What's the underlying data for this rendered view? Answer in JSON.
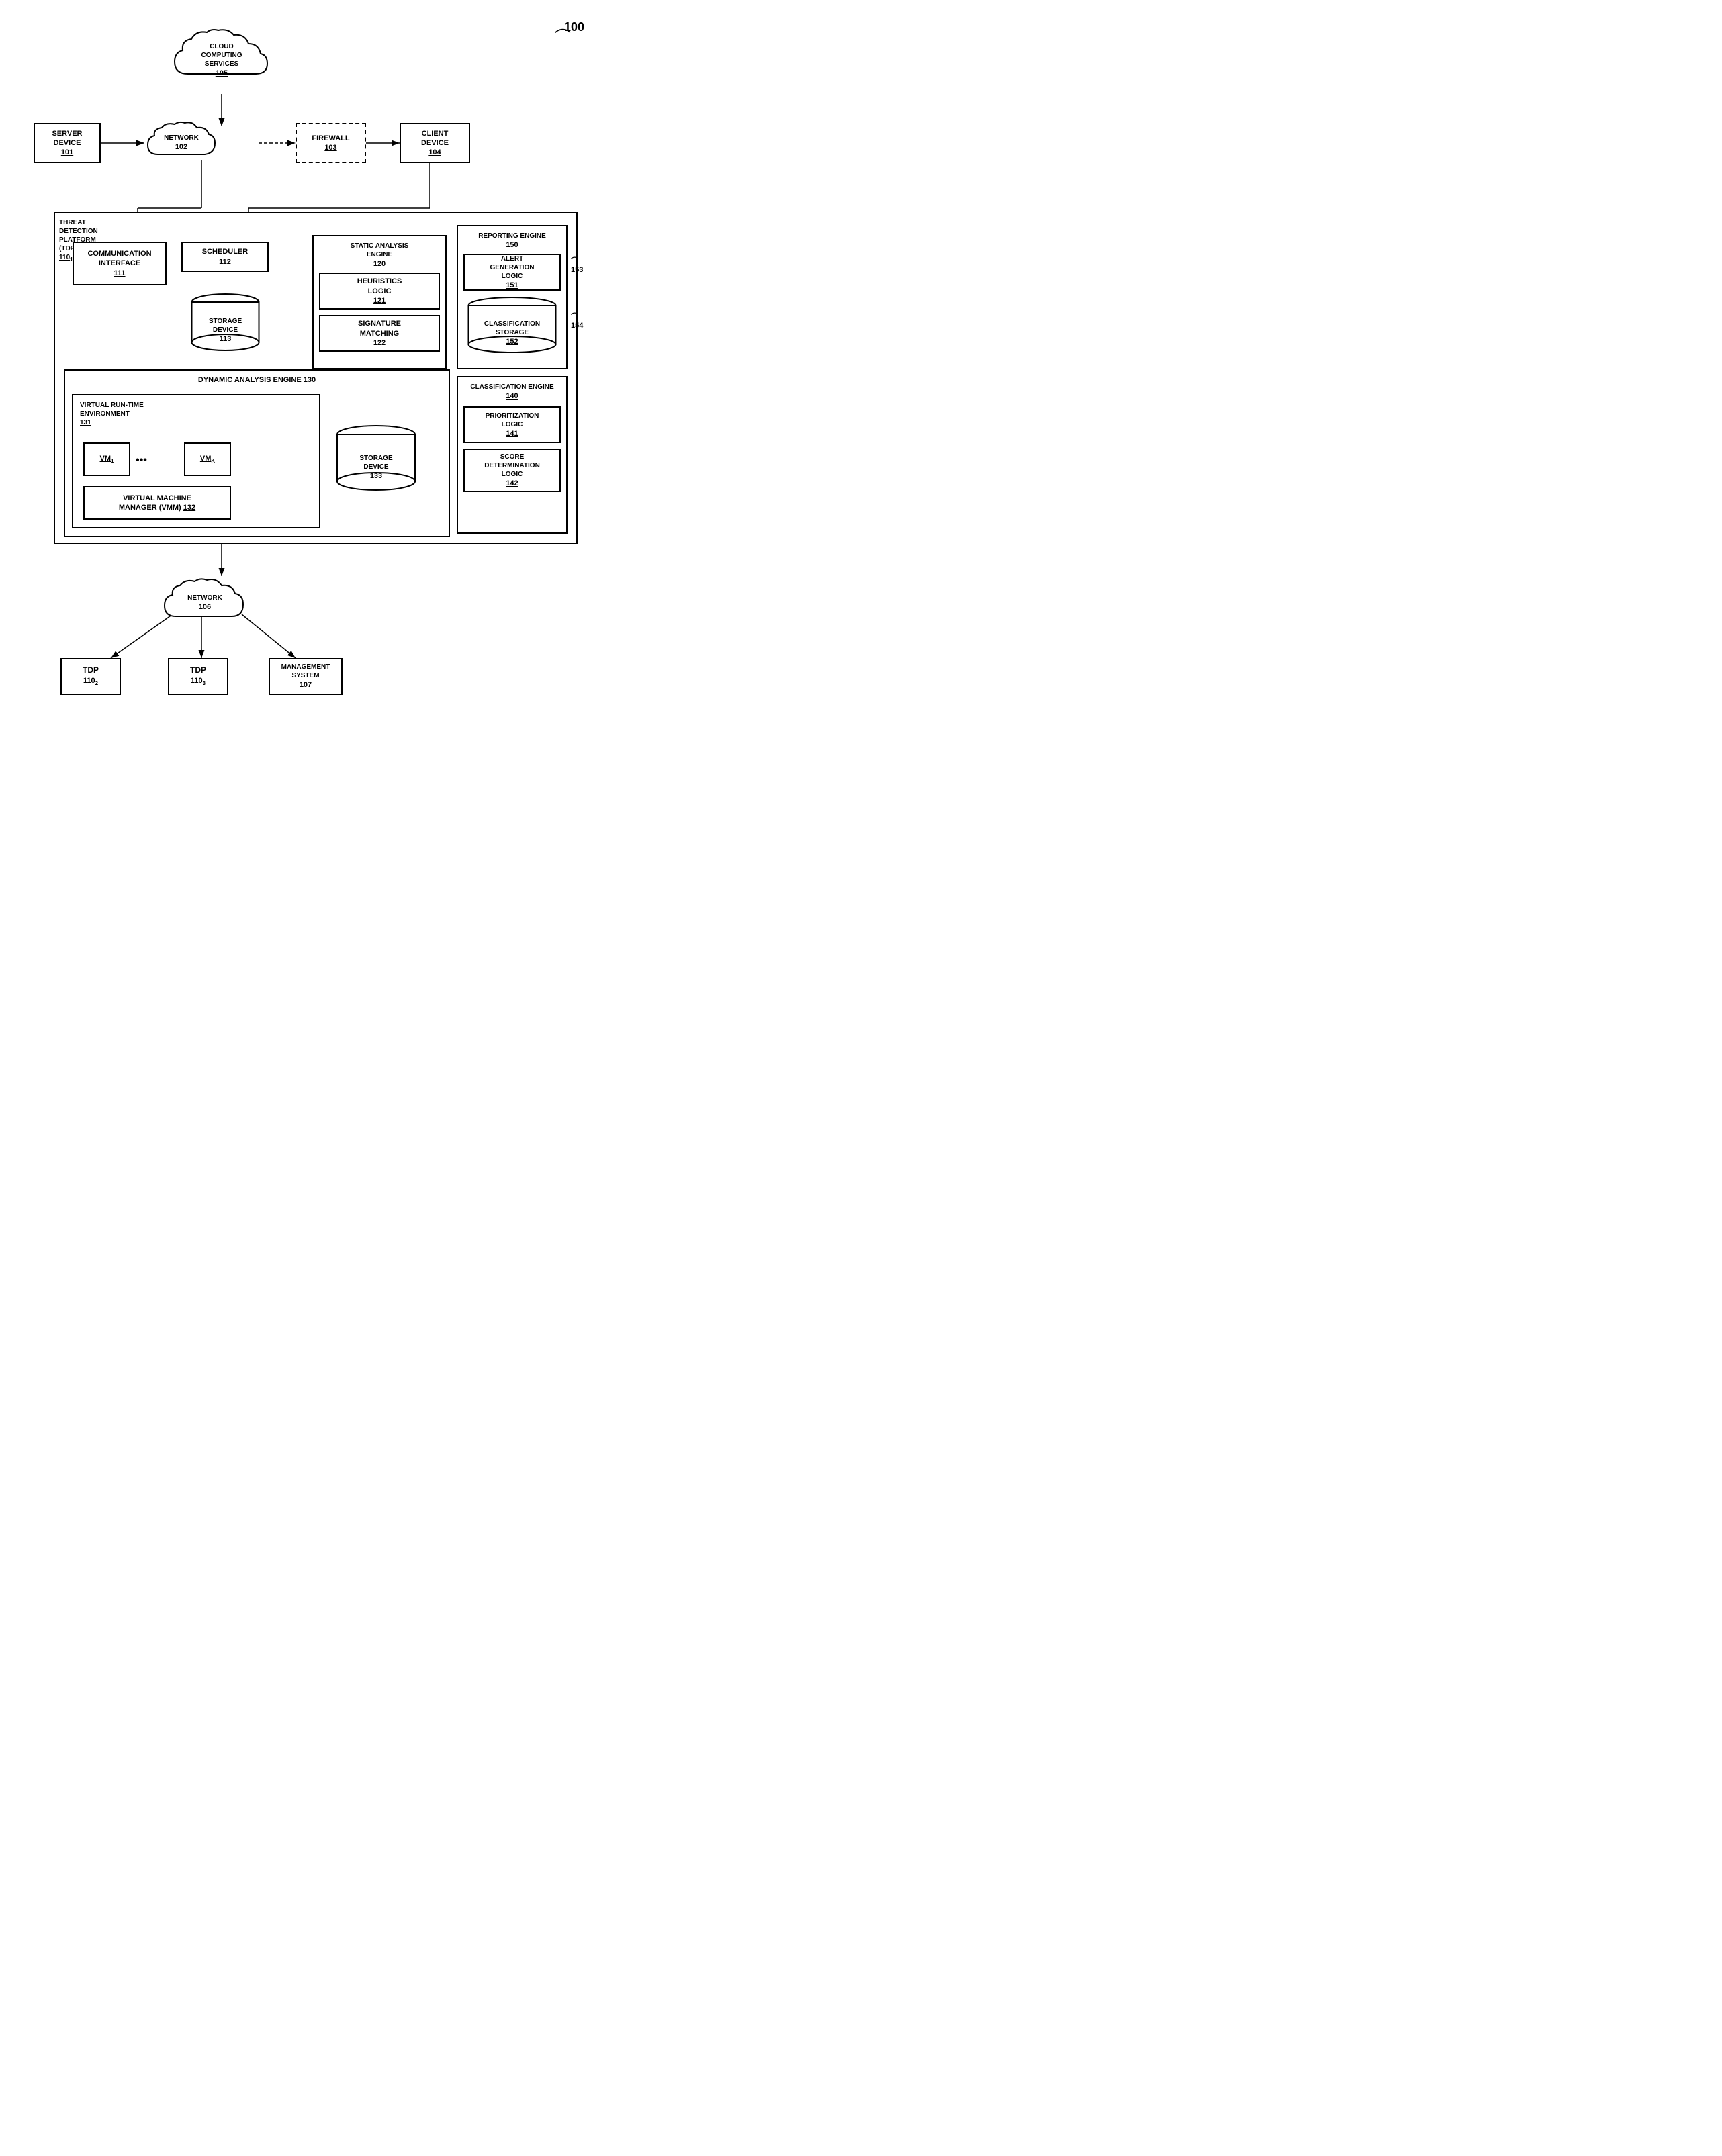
{
  "diagram": {
    "ref_number": "100",
    "top_section": {
      "cloud_computing": {
        "label": "CLOUD\nCOMPUTING\nSERVICES",
        "id": "105"
      },
      "server_device": {
        "label": "SERVER\nDEVICE",
        "id": "101"
      },
      "network_102": {
        "label": "NETWORK",
        "id": "102"
      },
      "firewall": {
        "label": "FIREWALL",
        "id": "103"
      },
      "client_device": {
        "label": "CLIENT\nDEVICE",
        "id": "104"
      }
    },
    "platform": {
      "label": "THREAT\nDETECTION\nPLATFORM\n(TDP)",
      "id": "110",
      "sub": "1",
      "communication_interface": {
        "label": "COMMUNICATION\nINTERFACE",
        "id": "111"
      },
      "scheduler": {
        "label": "SCHEDULER",
        "id": "112"
      },
      "storage_113": {
        "label": "STORAGE\nDEVICE",
        "id": "113"
      },
      "static_analysis": {
        "label": "STATIC ANALYSIS\nENGINE",
        "id": "120",
        "heuristics": {
          "label": "HEURISTICS\nLOGIC",
          "id": "121"
        },
        "signature": {
          "label": "SIGNATURE\nMATCHING",
          "id": "122"
        }
      },
      "reporting_engine": {
        "label": "REPORTING ENGINE",
        "id": "150",
        "alert_generation": {
          "label": "ALERT\nGENERATION\nLOGIC",
          "id": "151"
        },
        "classification_storage": {
          "label": "CLASSIFICATION\nSTORAGE",
          "id": "152"
        }
      },
      "reporting_arrows": {
        "out": "153",
        "in": "154"
      },
      "dynamic_analysis": {
        "label": "DYNAMIC ANALYSIS ENGINE",
        "id": "130",
        "virtual_runtime": {
          "label": "VIRTUAL RUN-TIME\nENVIRONMENT",
          "id": "131"
        },
        "vm1": "VM",
        "vm1_sub": "1",
        "vmk": "VM",
        "vmk_sub": "K",
        "dots": "•••",
        "storage_133": {
          "label": "STORAGE\nDEVICE",
          "id": "133"
        },
        "vmm": {
          "label": "VIRTUAL MACHINE\nMANAGER (VMM)",
          "id": "132"
        }
      },
      "classification_engine": {
        "label": "CLASSIFICATION ENGINE",
        "id": "140",
        "prioritization": {
          "label": "PRIORITIZATION\nLOGIC",
          "id": "141"
        },
        "score_determination": {
          "label": "SCORE\nDETERMINATION\nLOGIC",
          "id": "142"
        }
      }
    },
    "bottom_section": {
      "network_106": {
        "label": "NETWORK",
        "id": "106"
      },
      "tdp2": {
        "label": "TDP",
        "id": "110",
        "sub": "2"
      },
      "tdp3": {
        "label": "TDP",
        "id": "110",
        "sub": "3"
      },
      "management_system": {
        "label": "MANAGEMENT\nSYSTEM",
        "id": "107"
      }
    }
  }
}
